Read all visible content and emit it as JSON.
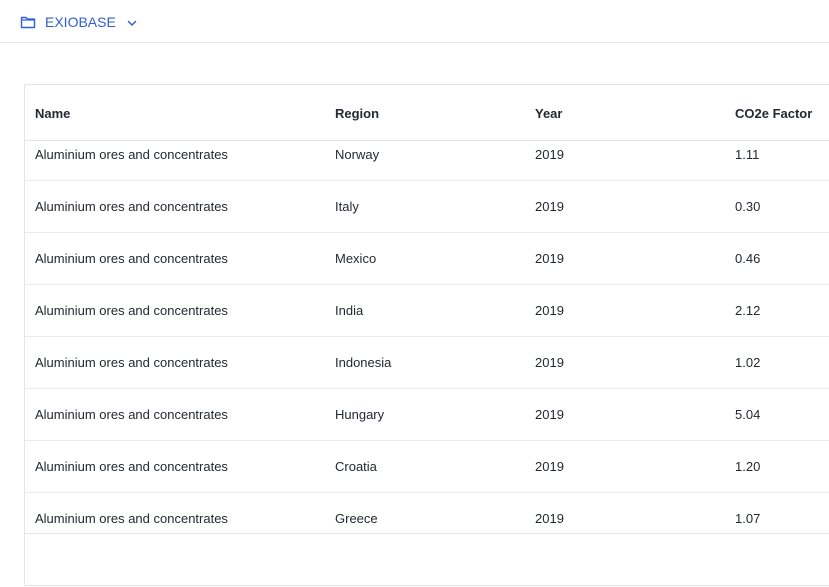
{
  "breadcrumb": {
    "label": "EXIOBASE",
    "folder_icon": "folder-icon",
    "chevron_icon": "chevron-down-icon",
    "accent_color": "#2f5fd0"
  },
  "table": {
    "columns": {
      "name": "Name",
      "region": "Region",
      "year": "Year",
      "factor": "CO2e Factor"
    },
    "rows": [
      {
        "name": "Aluminium ores and concentrates",
        "region": "Norway",
        "year": "2019",
        "factor": "1.11"
      },
      {
        "name": "Aluminium ores and concentrates",
        "region": "Italy",
        "year": "2019",
        "factor": "0.30"
      },
      {
        "name": "Aluminium ores and concentrates",
        "region": "Mexico",
        "year": "2019",
        "factor": "0.46"
      },
      {
        "name": "Aluminium ores and concentrates",
        "region": "India",
        "year": "2019",
        "factor": "2.12"
      },
      {
        "name": "Aluminium ores and concentrates",
        "region": "Indonesia",
        "year": "2019",
        "factor": "1.02"
      },
      {
        "name": "Aluminium ores and concentrates",
        "region": "Hungary",
        "year": "2019",
        "factor": "5.04"
      },
      {
        "name": "Aluminium ores and concentrates",
        "region": "Croatia",
        "year": "2019",
        "factor": "1.20"
      },
      {
        "name": "Aluminium ores and concentrates",
        "region": "Greece",
        "year": "2019",
        "factor": "1.07"
      }
    ]
  }
}
